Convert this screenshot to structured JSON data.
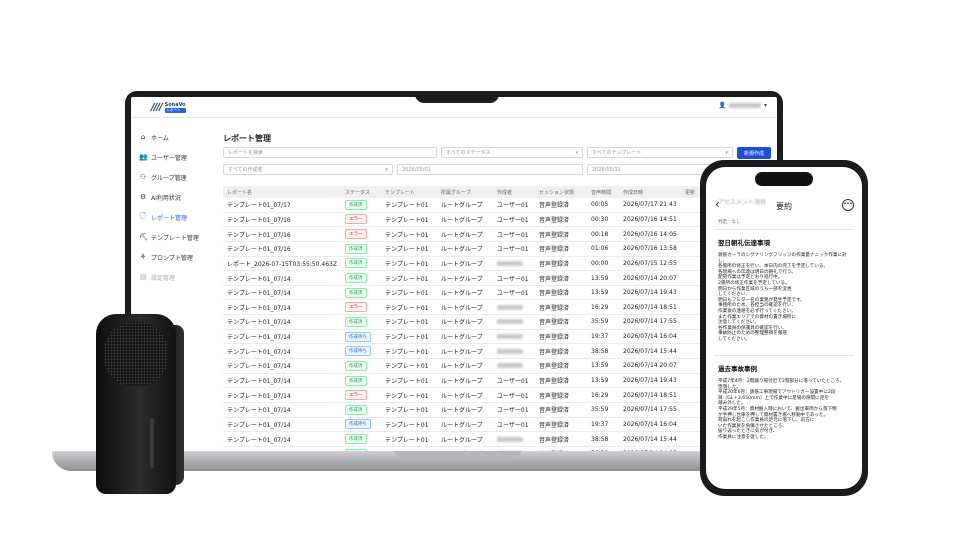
{
  "app": {
    "logo_text": "SonaVo",
    "logo_sub": "レポート"
  },
  "sidebar": {
    "items": [
      {
        "label": "ホーム",
        "icon": "home-icon"
      },
      {
        "label": "ユーザー管理",
        "icon": "users-icon"
      },
      {
        "label": "グループ管理",
        "icon": "group-icon"
      },
      {
        "label": "AI利用状況",
        "icon": "ai-gear-icon"
      },
      {
        "label": "レポート管理",
        "icon": "document-icon"
      },
      {
        "label": "テンプレート管理",
        "icon": "template-icon"
      },
      {
        "label": "プロンプト管理",
        "icon": "prompt-icon"
      },
      {
        "label": "設定管理",
        "icon": "settings-icon"
      }
    ]
  },
  "page": {
    "title": "レポート管理"
  },
  "filters": {
    "search_placeholder": "レポートを検索",
    "status": "すべてのステータス",
    "template": "すべてのテンプレート",
    "new_button": "新規作成",
    "author": "すべての作成者",
    "date_from": "2026/05/01",
    "date_to": "2026/05/31"
  },
  "table": {
    "columns": [
      "レポート名",
      "ステータス",
      "テンプレート",
      "所属グループ",
      "作成者",
      "セッション状態",
      "音声時間",
      "作成日時",
      "更新"
    ],
    "rows": [
      {
        "name": "テンプレート01_07/17",
        "status": "作成済",
        "kind": "ok",
        "template": "テンプレート01",
        "group": "ルートグループ",
        "author": "ユーザー01",
        "session": "音声登録済",
        "duration": "00:05",
        "created": "2026/07/17 21:43"
      },
      {
        "name": "テンプレート01_07/16",
        "status": "エラー",
        "kind": "err",
        "template": "テンプレート01",
        "group": "ルートグループ",
        "author": "ユーザー01",
        "session": "音声登録済",
        "duration": "00:30",
        "created": "2026/07/16 14:51"
      },
      {
        "name": "テンプレート01_07/16",
        "status": "エラー",
        "kind": "err",
        "template": "テンプレート01",
        "group": "ルートグループ",
        "author": "ユーザー01",
        "session": "音声登録済",
        "duration": "00:18",
        "created": "2026/07/16 14:05"
      },
      {
        "name": "テンプレート01_07/16",
        "status": "作成済",
        "kind": "ok",
        "template": "テンプレート01",
        "group": "ルートグループ",
        "author": "ユーザー01",
        "session": "音声登録済",
        "duration": "01:06",
        "created": "2026/07/16 13:58"
      },
      {
        "name": "レポート_2026-07-15T03:55:50.463Z",
        "status": "作成済",
        "kind": "ok",
        "template": "テンプレート01",
        "group": "ルートグループ",
        "author": "",
        "session": "音声登録済",
        "duration": "00:00",
        "created": "2026/07/15 12:55"
      },
      {
        "name": "テンプレート01_07/14",
        "status": "作成済",
        "kind": "ok",
        "template": "テンプレート01",
        "group": "ルートグループ",
        "author": "ユーザー01",
        "session": "音声登録済",
        "duration": "13:59",
        "created": "2026/07/14 20:07"
      },
      {
        "name": "テンプレート01_07/14",
        "status": "作成済",
        "kind": "ok",
        "template": "テンプレート01",
        "group": "ルートグループ",
        "author": "ユーザー01",
        "session": "音声登録済",
        "duration": "13:59",
        "created": "2026/07/14 19:43"
      },
      {
        "name": "テンプレート01_07/14",
        "status": "エラー",
        "kind": "err",
        "template": "テンプレート01",
        "group": "ルートグループ",
        "author": "",
        "session": "音声登録済",
        "duration": "16:29",
        "created": "2026/07/14 18:51"
      },
      {
        "name": "テンプレート01_07/14",
        "status": "作成済",
        "kind": "ok",
        "template": "テンプレート01",
        "group": "ルートグループ",
        "author": "",
        "session": "音声登録済",
        "duration": "35:59",
        "created": "2026/07/14 17:55"
      },
      {
        "name": "テンプレート01_07/14",
        "status": "作成待ち",
        "kind": "wait",
        "template": "テンプレート01",
        "group": "ルートグループ",
        "author": "",
        "session": "音声登録済",
        "duration": "19:37",
        "created": "2026/07/14 16:04"
      },
      {
        "name": "テンプレート01_07/14",
        "status": "作成待ち",
        "kind": "wait",
        "template": "テンプレート01",
        "group": "ルートグループ",
        "author": "",
        "session": "音声登録済",
        "duration": "38:58",
        "created": "2026/07/14 15:44"
      },
      {
        "name": "テンプレート01_07/14",
        "status": "作成済",
        "kind": "ok",
        "template": "テンプレート01",
        "group": "ルートグループ",
        "author": "",
        "session": "音声登録済",
        "duration": "13:59",
        "created": "2026/07/14 20:07"
      },
      {
        "name": "テンプレート01_07/14",
        "status": "作成済",
        "kind": "ok",
        "template": "テンプレート01",
        "group": "ルートグループ",
        "author": "ユーザー01",
        "session": "音声登録済",
        "duration": "13:59",
        "created": "2026/07/14 19:43"
      },
      {
        "name": "テンプレート01_07/14",
        "status": "エラー",
        "kind": "err",
        "template": "テンプレート01",
        "group": "ルートグループ",
        "author": "ユーザー01",
        "session": "音声登録済",
        "duration": "16:29",
        "created": "2026/07/14 18:51"
      },
      {
        "name": "テンプレート01_07/14",
        "status": "作成済",
        "kind": "ok",
        "template": "テンプレート01",
        "group": "ルートグループ",
        "author": "ユーザー01",
        "session": "音声登録済",
        "duration": "35:59",
        "created": "2026/07/14 17:55"
      },
      {
        "name": "テンプレート01_07/14",
        "status": "作成待ち",
        "kind": "wait",
        "template": "テンプレート01",
        "group": "ルートグループ",
        "author": "ユーザー01",
        "session": "音声登録済",
        "duration": "19:37",
        "created": "2026/07/14 16:04"
      },
      {
        "name": "テンプレート01_07/14",
        "status": "作成済",
        "kind": "ok",
        "template": "テンプレート01",
        "group": "ルートグループ",
        "author": "",
        "session": "音声登録済",
        "duration": "38:58",
        "created": "2026/07/14 15:44"
      },
      {
        "name": "テンプレート01_07/14",
        "status": "作成済",
        "kind": "ok",
        "template": "テンプレート01",
        "group": "ルートグループ",
        "author": "",
        "session": "音声登録済",
        "duration": "56:39",
        "created": "2026/07/14 14:05"
      }
    ]
  },
  "phone": {
    "title": "要約",
    "ghost": "アセスメント項目",
    "correction": "判定：なし",
    "sections": [
      {
        "heading": "翌日朝礼伝達事項",
        "text": "鉄筋カーラのシグナリングフリッジの作業量ナニック作業に対し、\n各箇所の修正を行い、本日内の完了を予定している。\n各現場への伝達は明日の朝礼で行う。\n配管作業は予定どおり進行中。\n2箇所の修正作業を予定している。\n明日から作業区域のうち一部を変更\nしてください。\n明日もフルタ一名の業務が発生予定です。\n事務所のため、各担当の確認を行い、\n作業後の連絡を必ず行ってください。\nまた作業エリアでの資材の置き場所に\n注意してください。\n各作業員の保護具の確認を行い、\n事故防止のための整理整頓を徹底\nしてください。"
      },
      {
        "heading": "過去事故事例",
        "text": "平成7年4月：2階踊り場付近で2階部分に落っていたところ、\n墜落した。\n平成20年6月：鉄筋工事現場でアウトリガー設置中に2段\n目（GL＋3,650mm）上で作業中に足場の隙間に足を\n踏み外した。\n平成29年5月：資材搬入時において、搬出車両から落下物\nが手押し台車を押して資材置き場へ移動中であった。\n荷崩れを起こし作業員の足元に落下し、前方に\nいた作業員を負傷させたところ、\n振り返ったときに気が付き、\n作業員に注意を促した。"
      }
    ]
  }
}
